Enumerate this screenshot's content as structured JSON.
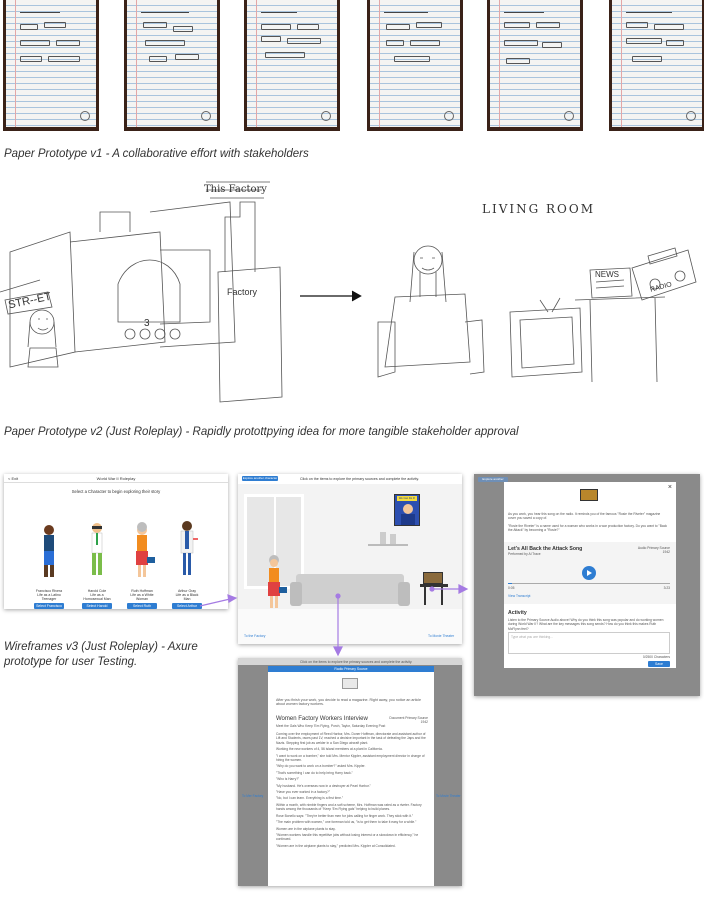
{
  "captions": {
    "v1": "Paper Prototype v1 - A collaborative effort with stakeholders",
    "v2": "Paper Prototype v2 (Just Roleplay) - Rapidly protottpying idea for more tangible stakeholder approval",
    "v3": "Wireframes v3 (Just Roleplay) - Axure prototype for user Testing."
  },
  "sketch": {
    "street": "STR--ET",
    "factory_sign": "This Factory",
    "factory_label": "Factory",
    "theater_num": "3",
    "living_room": "LIVING ROOM",
    "news": "NEWS",
    "radio": "RADIO"
  },
  "wire1": {
    "back": "< Exit",
    "title": "World War II Roleplay",
    "prompt": "Select a Character to begin exploring their story",
    "characters": [
      {
        "name": "Francisco Rivera",
        "desc": "Life as a Latino Teenager",
        "button": "Select Francisco"
      },
      {
        "name": "Harold Cole",
        "desc": "Life as a Homosexual Man",
        "button": "Select Harold"
      },
      {
        "name": "Ruth Hoffman",
        "desc": "Life as a White Woman",
        "button": "Select Ruth"
      },
      {
        "name": "Arthur Gray",
        "desc": "Life as a Black Man",
        "button": "Select Arthur"
      }
    ]
  },
  "wire2": {
    "explore_btn": "Explore another character",
    "instruction": "Click on the items to explore the primary sources and complete the activity.",
    "poster": "We Can Do It!",
    "to_factory": "To the Factory",
    "to_theater": "To Movie Theater"
  },
  "wire3": {
    "explore_btn": "Explore another",
    "close": "×",
    "intro": "As you work, you hear this song on the radio. It reminds you of the famous \"Rosie the Riveter\" magazine cover you saved a copy of.",
    "intro2": "\"Rosie the Riveter\" is a name used for a woman who works in a war production factory. Do you want to \"Back the Attack\" by becoming a \"Rosie?\"",
    "song_title": "Let's All Back the Attack Song",
    "performer": "Performed by Al Trace",
    "source_label": "Audio Primary Source",
    "source_year": "1942",
    "time_start": "0:05",
    "time_end": "3:23",
    "transcript": "View Transcript",
    "activity_title": "Activity",
    "activity_text": "Listen to the Primary Source Audio above! Why do you think this song was popular and do working women during World War II? What are the key messages this song sends? How do you think this makes Ruth McFlynn feel?",
    "placeholder": "Type what you are thinking...",
    "char_count": "0/2500 Characters",
    "save": "Save"
  },
  "wire4": {
    "instruction": "Click on the items to explore the primary sources and complete the activity.",
    "modal_title": "Radio Primary Source",
    "intro": "After you finish your work, you decide to read a magazine. Right away, you notice an article about women factory workers.",
    "article_title": "Women Factory Workers Interview",
    "article_meta": "Meet the Gals Who Keep 'Em Flying, Porch, Taylor, Saturday Evening Post",
    "source_label": "Document Primary Source",
    "source_year": "1942",
    "paragraphs": [
      "Coming over the employment of Reed Harbor, Mrs. Doner Hoffman, directorate and assistant author of Lift and Students, races past 1V, reached a decisive important in the task of defeating the Japs and the Nazis. Stepping first job as welder in a San Diego aircraft plant.",
      "Working the new workers of 4, 56 island members at a plant in California.",
      "\"I want to work on a bomber,\" she told Mrs. Mentor Kippler, assistant employment director in charge of hiring the women.",
      "\"Why do you want to work on a bomber?\" asked Mrs. Kippler.",
      "\"That's something I can do to help bring Harry back.\"",
      "\"Who is Harry?\"",
      "\"My husband. He's overseas now in a destroyer at Pearl Harbor.\"",
      "\"Have you ever worked in a factory?\"",
      "\"No, but I can learn. Everything is a first time.\"",
      "Within a month, with nimble fingers and a soft scheme, Mrs. Hoffman was rated as a riveter. Factory hands among the thousands of \"Keep 'Em Flying gals\" helping to build planes.",
      "Rose Bonello says: \"They're better than men for jobs calling for finger work. They stick with it.\"",
      "\"The main problem with women,\" one foreman told us, \"is to get them to take it easy for a while.\"",
      "Women are in the airplane plants to stay.",
      "\"Women workers handle this repetitive jobs without losing interest or a slowdown in efficiency,\" he continued.",
      "\"Women are in the airplane plants to stay,\" predicted Mrs. Kippler at Consolidated."
    ],
    "to_factory": "To Mer Factory",
    "to_theater": "To Movie Theater"
  },
  "colors": {
    "accent": "#2e7dd2",
    "arrow": "#a57be3",
    "overlay": "#8a8a8a"
  }
}
